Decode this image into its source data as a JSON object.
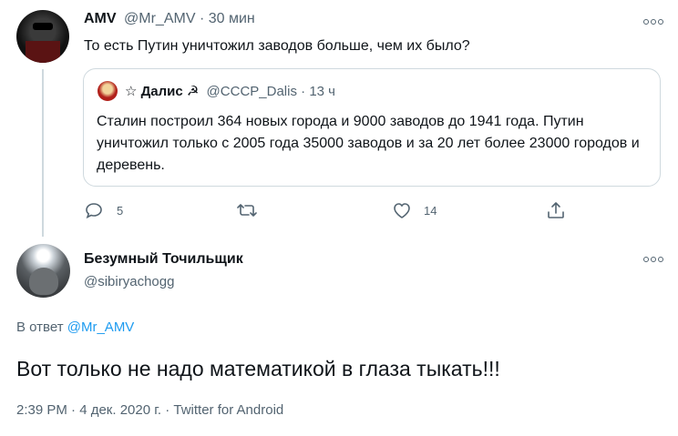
{
  "parent_tweet": {
    "author_name": "AMV",
    "handle": "@Mr_AMV",
    "separator": "·",
    "time_ago": "30 мин",
    "text": "То есть Путин уничтожил заводов больше, чем их было?",
    "quoted": {
      "author_name": "Далис",
      "handle": "@CCCP_Dalis",
      "separator": "·",
      "time_ago": "13 ч",
      "text": "Сталин построил 364 новых города и 9000 заводов до 1941 года. Путин уничтожил только с 2005 года 35000 заводов и за 20 лет более 23000 городов и деревень."
    },
    "actions": {
      "reply_count": "5",
      "retweet_count": "",
      "like_count": "14"
    }
  },
  "main_tweet": {
    "author_name": "Безумный Точильщик",
    "handle": "@sibiryachogg",
    "reply_prefix": "В ответ",
    "reply_to": "@Mr_AMV",
    "text": "Вот только не надо математикой в глаза тыкать!!!",
    "meta": "2:39 PM · 4 дек. 2020 г. · Twitter for Android"
  },
  "icons": {
    "reply": "reply-icon",
    "retweet": "retweet-icon",
    "like": "heart-icon",
    "share": "share-icon",
    "more": "more-dots-icon",
    "flag": "flag-icon",
    "star": "star-icon",
    "hammer_sickle": "hammer-sickle-icon"
  },
  "colors": {
    "link": "#1d9bf0",
    "muted": "#536471",
    "border": "#cfd9de",
    "thread_line": "#cfd9de"
  }
}
